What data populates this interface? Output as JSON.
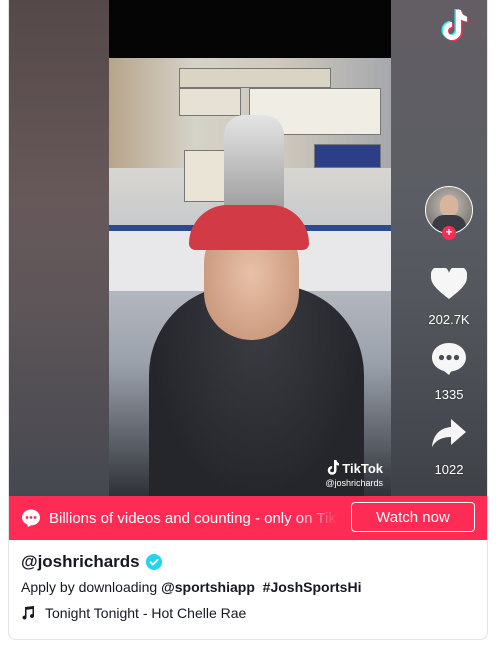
{
  "video": {
    "watermark_brand": "TikTok",
    "watermark_user": "@joshrichards"
  },
  "actions": {
    "likes": "202.7K",
    "comments": "1335",
    "shares": "1022"
  },
  "promo": {
    "text": "Billions of videos and counting - only on TikTok",
    "button_label": "Watch now"
  },
  "post": {
    "username": "@joshrichards",
    "description_prefix": "Apply by downloading ",
    "mention": "@sportshiapp",
    "hashtag": "#JoshSportsHi",
    "music": "Tonight Tonight - Hot Chelle Rae"
  },
  "colors": {
    "brand_red": "#fe2c55",
    "verified_blue": "#20d5ec",
    "text_dark": "#161823"
  }
}
